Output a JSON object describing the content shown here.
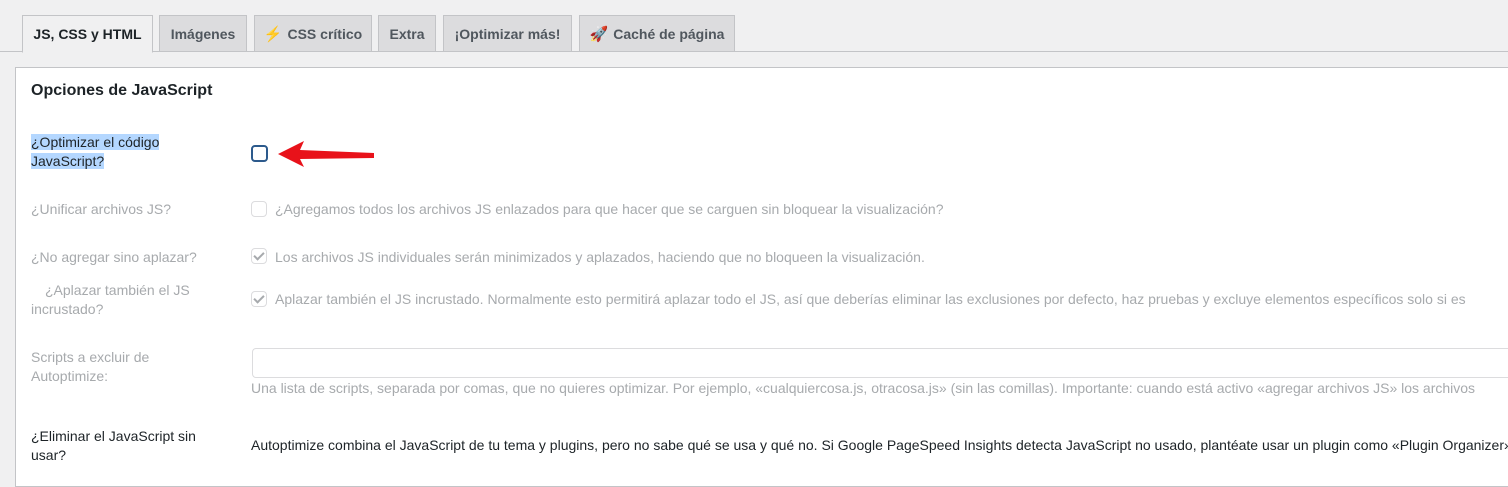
{
  "tabs": [
    {
      "label": "JS, CSS y HTML",
      "active": true
    },
    {
      "label": "Imágenes"
    },
    {
      "icon": "lightning-icon",
      "glyph": "⚡",
      "label": "CSS crítico"
    },
    {
      "label": "Extra"
    },
    {
      "label": "¡Optimizar más!"
    },
    {
      "icon": "rocket-icon",
      "glyph": "🚀",
      "label": "Caché de página"
    }
  ],
  "section": {
    "title": "Opciones de JavaScript"
  },
  "options": {
    "optimize_js": {
      "label": "¿Optimizar el código JavaScript?",
      "label_line1": "¿Optimizar el código",
      "label_line2": "JavaScript?",
      "checked": false
    },
    "aggregate_js": {
      "label": "¿Unificar archivos JS?",
      "checked": false,
      "disabled": true,
      "description": "¿Agregamos todos los archivos JS enlazados para que hacer que se carguen sin bloquear la visualización?"
    },
    "defer_js": {
      "label": "¿No agregar sino aplazar?",
      "checked": true,
      "disabled": true,
      "description": "Los archivos JS individuales serán minimizados y aplazados, haciendo que no bloqueen la visualización."
    },
    "defer_inline": {
      "label_line1": "¿Aplazar también el JS",
      "label_line2": "incrustado?",
      "checked": true,
      "disabled": true,
      "description": "Aplazar también el JS incrustado. Normalmente esto permitirá aplazar todo el JS, así que deberías eliminar las exclusiones por defecto, haz pruebas y excluye elementos específicos solo si es"
    },
    "exclude_scripts": {
      "label_line1": "Scripts a excluir de",
      "label_line2": "Autoptimize:",
      "value": "",
      "help": "Una lista de scripts, separada por comas, que no quieres optimizar. Por ejemplo, «cualquiercosa.js, otracosa.js» (sin las comillas). Importante: cuando está activo «agregar archivos JS» los archivos"
    },
    "remove_unused": {
      "label_line1": "¿Eliminar el JavaScript sin",
      "label_line2": "usar?",
      "description": "Autoptimize combina el JavaScript de tu tema y plugins, pero no sabe qué se usa y qué no. Si Google PageSpeed Insights detecta JavaScript no usado, plantéate usar un plugin como «Plugin Organizer»"
    }
  },
  "colors": {
    "accent": "#2c5a8c",
    "annotation_arrow": "#e8121a",
    "selection": "#b4d7ff"
  }
}
